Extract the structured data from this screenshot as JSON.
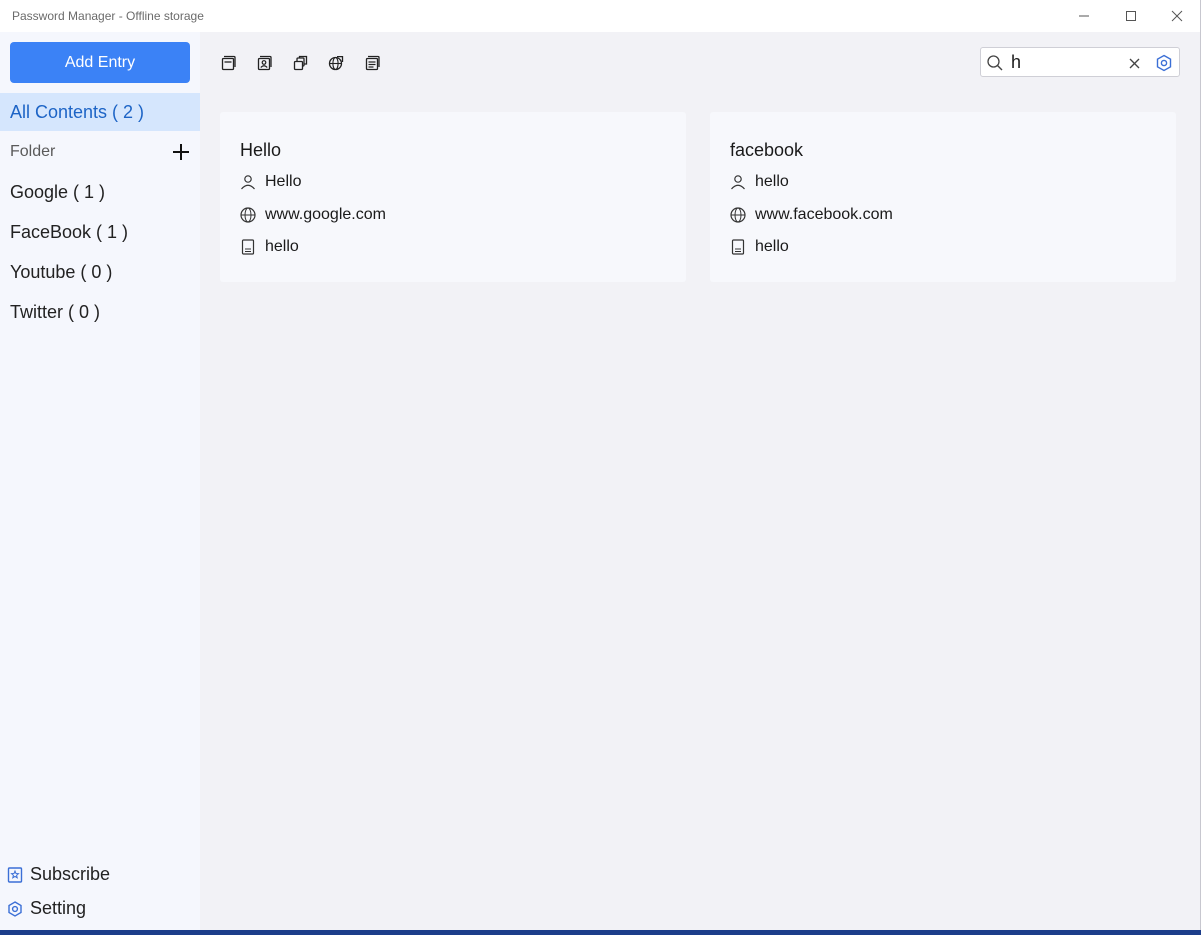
{
  "window": {
    "title": "Password Manager - Offline storage",
    "controls": [
      "minimize-icon",
      "maximize-icon",
      "close-icon"
    ]
  },
  "sidebar": {
    "add_entry_label": "Add Entry",
    "all_contents_label": "All Contents ( 2 )",
    "folder_header": "Folder",
    "folders": [
      {
        "label": "Google ( 1 )"
      },
      {
        "label": "FaceBook ( 1 )"
      },
      {
        "label": "Youtube ( 0 )"
      },
      {
        "label": "Twitter ( 0 )"
      }
    ],
    "subscribe_label": "Subscribe",
    "setting_label": "Setting"
  },
  "toolbar": {
    "icons": [
      "all-items-icon",
      "login-icon",
      "copy-icon",
      "web-icon",
      "notes-icon"
    ]
  },
  "search": {
    "value": "h",
    "placeholder": ""
  },
  "entries": [
    {
      "title": "Hello",
      "username": "Hello",
      "url": "www.google.com",
      "note": "hello"
    },
    {
      "title": "facebook",
      "username": "hello",
      "url": "www.facebook.com",
      "note": "hello"
    }
  ],
  "colors": {
    "accent": "#3b82f6",
    "selected_bg": "#d5e6fd",
    "selected_text": "#1d64c6",
    "sidebar_bg": "#f5f7fd",
    "main_bg": "#f2f2f6"
  }
}
